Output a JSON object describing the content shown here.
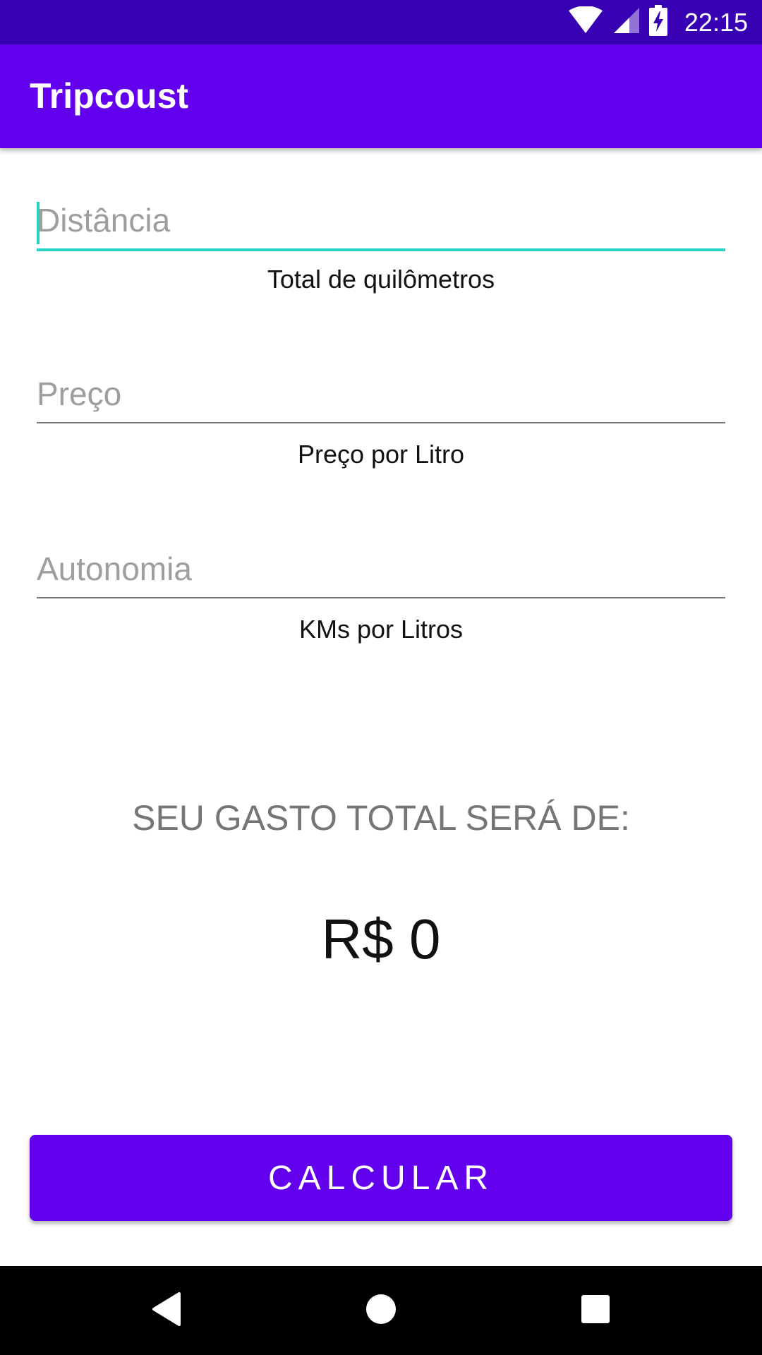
{
  "status_bar": {
    "time": "22:15",
    "icons": [
      "wifi-icon",
      "cell-signal-icon",
      "battery-charging-icon"
    ],
    "background": "#3700b3"
  },
  "app_bar": {
    "title": "Tripcoust",
    "background": "#6200ee"
  },
  "form": {
    "distance": {
      "placeholder": "Distância",
      "value": "",
      "helper": "Total de quilômetros",
      "focused": true
    },
    "price": {
      "placeholder": "Preço",
      "value": "",
      "helper": "Preço por Litro"
    },
    "autonomy": {
      "placeholder": "Autonomia",
      "value": "",
      "helper": "KMs por Litros"
    }
  },
  "result": {
    "label": "SEU GASTO TOTAL SERÁ DE:",
    "value": "R$ 0"
  },
  "calculate_button": {
    "label": "CALCULAR"
  },
  "nav_bar": {
    "icons": [
      "back-icon",
      "home-icon",
      "recents-icon"
    ]
  },
  "colors": {
    "primary": "#6200ee",
    "primary_dark": "#3700b3",
    "accent": "#26d4c4"
  }
}
